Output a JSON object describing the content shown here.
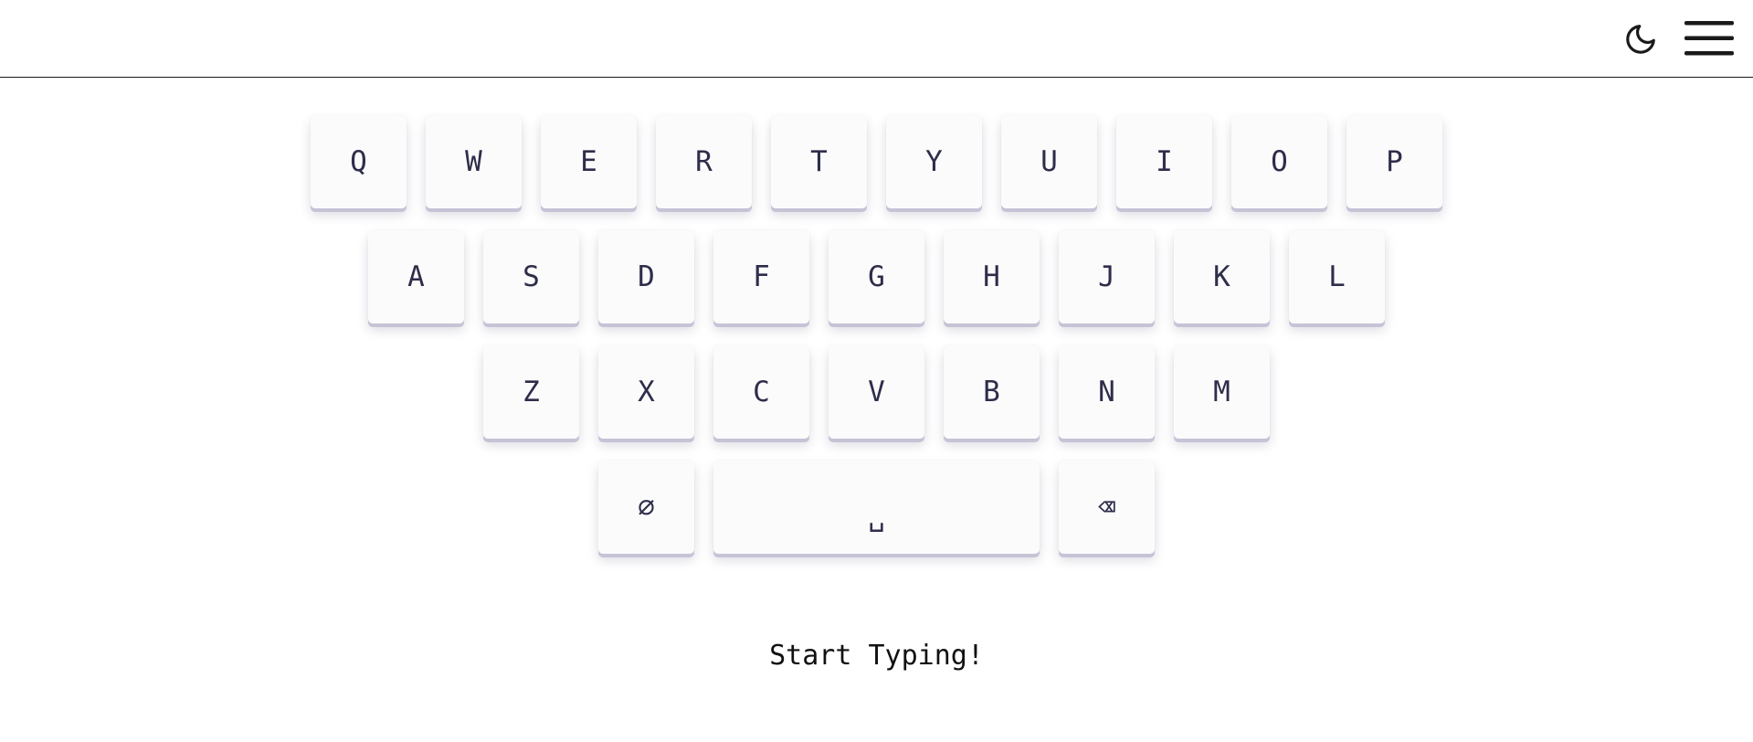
{
  "header": {
    "theme_icon": "moon-icon",
    "menu_icon": "hamburger-menu-icon"
  },
  "keyboard": {
    "rows": [
      [
        "Q",
        "W",
        "E",
        "R",
        "T",
        "Y",
        "U",
        "I",
        "O",
        "P"
      ],
      [
        "A",
        "S",
        "D",
        "F",
        "G",
        "H",
        "J",
        "K",
        "L"
      ],
      [
        "Z",
        "X",
        "C",
        "V",
        "B",
        "N",
        "M"
      ],
      [
        "∅",
        "␣",
        "⌫"
      ]
    ]
  },
  "status": {
    "text": "Start Typing!"
  },
  "colors": {
    "key_background": "#fbfbfc",
    "key_text": "#2e2d4a",
    "key_shadow": "#c6c3d6",
    "header_border": "#1a1a1a"
  }
}
